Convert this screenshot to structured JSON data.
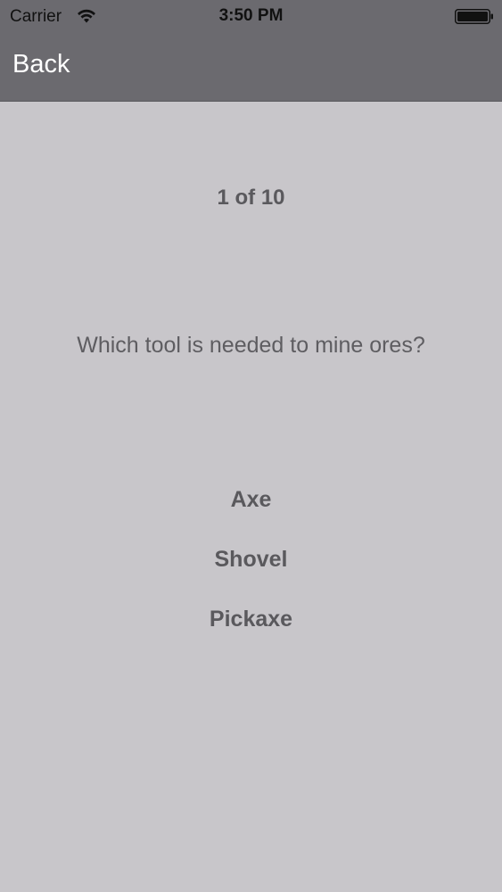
{
  "status_bar": {
    "carrier": "Carrier",
    "time": "3:50 PM",
    "wifi_icon": "wifi-icon",
    "battery_icon": "battery-icon"
  },
  "nav": {
    "back_label": "Back",
    "bar_color": "#6b6a6f"
  },
  "quiz": {
    "progress": "1 of 10",
    "question": "Which tool is needed to mine ores?",
    "answers": [
      "Axe",
      "Shovel",
      "Pickaxe"
    ]
  },
  "colors": {
    "background": "#c8c6ca",
    "text": "#5a595d",
    "nav_text": "#ffffff"
  }
}
